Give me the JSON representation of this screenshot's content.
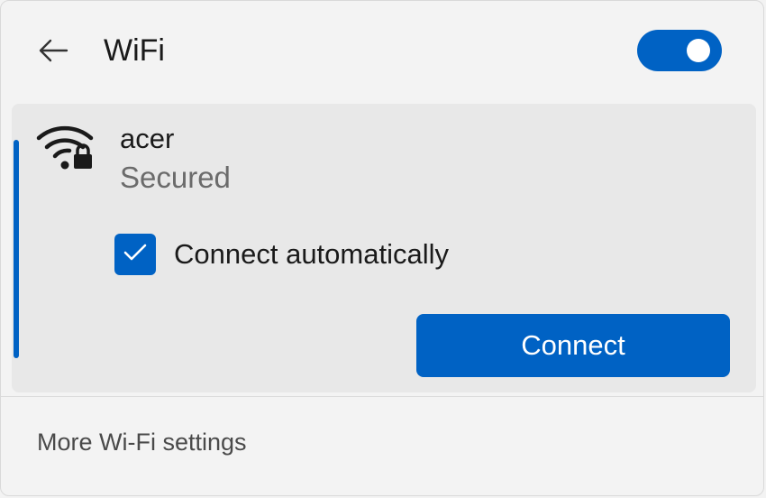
{
  "header": {
    "back_icon": "arrow-left-icon",
    "title": "WiFi",
    "wifi_toggle": {
      "state": "on",
      "color": "#0062c4"
    }
  },
  "network": {
    "icon": "wifi-secured-icon",
    "name": "acer",
    "status": "Secured",
    "connect_automatically": {
      "label": "Connect automatically",
      "checked": true
    },
    "connect_button": "Connect"
  },
  "footer": {
    "more_settings": "More Wi-Fi settings"
  },
  "colors": {
    "accent": "#0062c4",
    "background": "#f3f3f3",
    "card": "#e8e8e8"
  }
}
